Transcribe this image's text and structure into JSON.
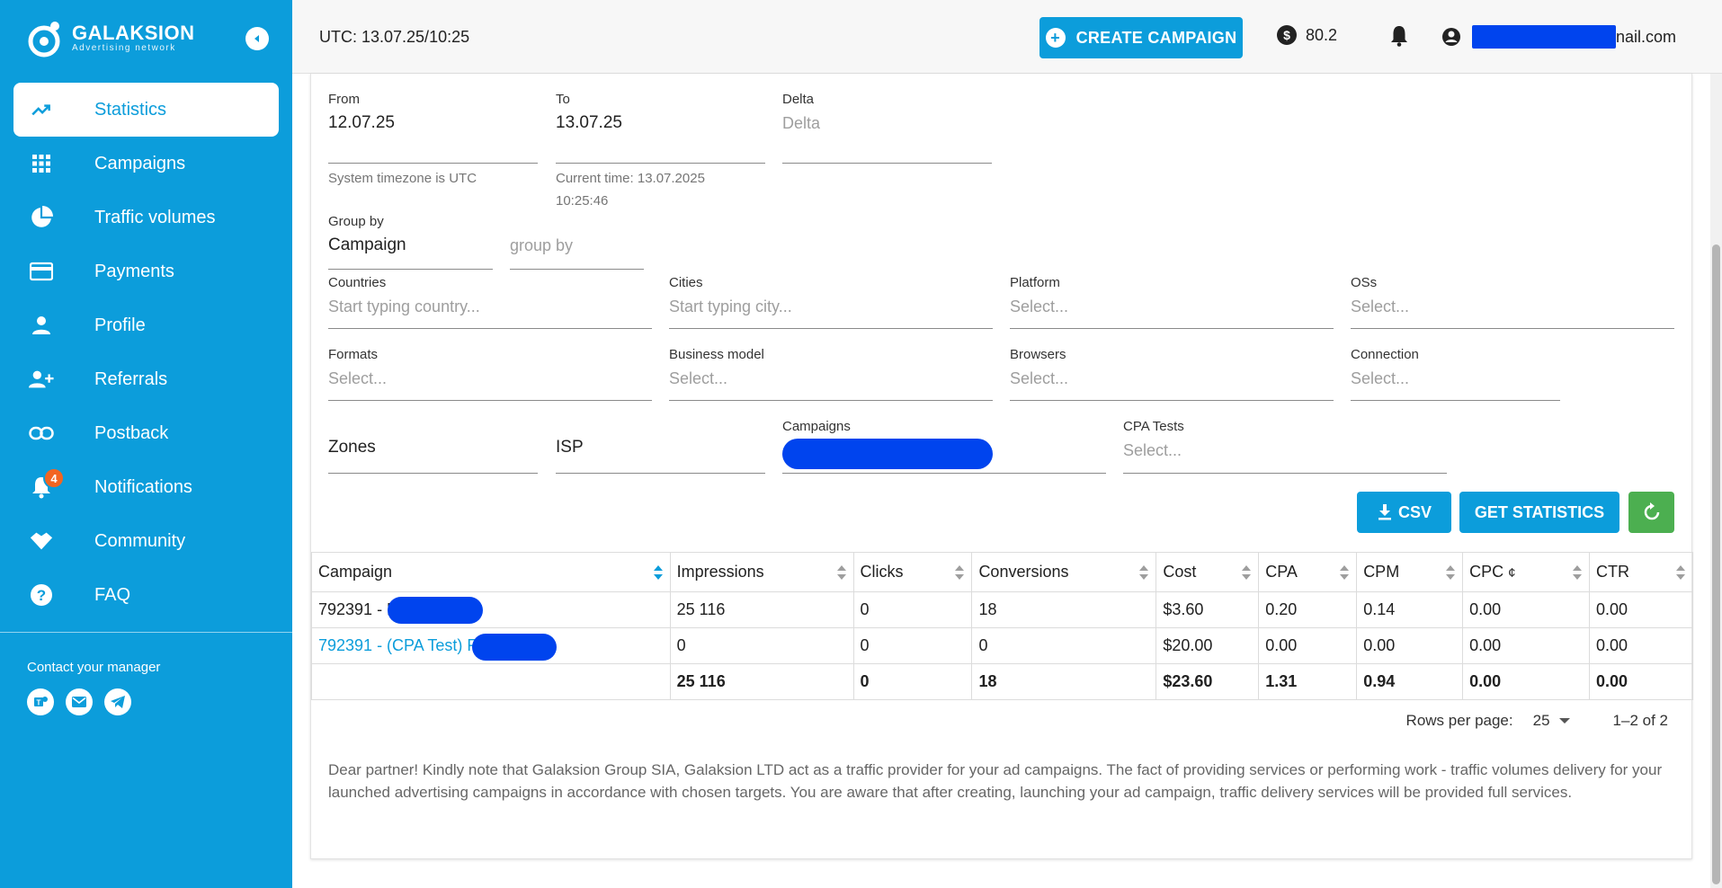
{
  "brand": {
    "name": "GALAKSION",
    "tagline": "Advertising network"
  },
  "sidebar": {
    "items": [
      {
        "label": "Statistics",
        "icon": "trending-up-icon",
        "active": true
      },
      {
        "label": "Campaigns",
        "icon": "grid-icon"
      },
      {
        "label": "Traffic volumes",
        "icon": "pie-chart-icon"
      },
      {
        "label": "Payments",
        "icon": "credit-card-icon"
      },
      {
        "label": "Profile",
        "icon": "person-icon"
      },
      {
        "label": "Referrals",
        "icon": "add-user-icon"
      },
      {
        "label": "Postback",
        "icon": "link-icon"
      },
      {
        "label": "Notifications",
        "icon": "bell-icon",
        "badge": "4"
      },
      {
        "label": "Community",
        "icon": "handshake-icon"
      },
      {
        "label": "FAQ",
        "icon": "help-icon"
      }
    ],
    "contact_label": "Contact your manager",
    "contact_icons": [
      "teams-icon",
      "mail-icon",
      "telegram-icon"
    ]
  },
  "header": {
    "utc": "UTC: 13.07.25/10:25",
    "create_label": "CREATE CAMPAIGN",
    "balance": "80.2",
    "email_suffix": "nail.com"
  },
  "filters": {
    "from": {
      "label": "From",
      "value": "12.07.25",
      "hint": "System timezone is UTC"
    },
    "to": {
      "label": "To",
      "value": "13.07.25",
      "hint_line1": "Current time: 13.07.2025",
      "hint_line2": "10:25:46"
    },
    "delta": {
      "label": "Delta",
      "placeholder": "Delta"
    },
    "group_by": {
      "label": "Group by",
      "value": "Campaign",
      "placeholder": "group by"
    },
    "countries": {
      "label": "Countries",
      "placeholder": "Start typing country..."
    },
    "cities": {
      "label": "Cities",
      "placeholder": "Start typing city..."
    },
    "platform": {
      "label": "Platform",
      "placeholder": "Select..."
    },
    "oss": {
      "label": "OSs",
      "placeholder": "Select..."
    },
    "formats": {
      "label": "Formats",
      "placeholder": "Select..."
    },
    "business_model": {
      "label": "Business model",
      "placeholder": "Select..."
    },
    "browsers": {
      "label": "Browsers",
      "placeholder": "Select..."
    },
    "connection": {
      "label": "Connection",
      "placeholder": "Select..."
    },
    "zones": {
      "value": "Zones"
    },
    "isp": {
      "value": "ISP"
    },
    "campaigns": {
      "label": "Campaigns"
    },
    "cpa_tests": {
      "label": "CPA Tests",
      "placeholder": "Select..."
    }
  },
  "actions": {
    "csv_label": "CSV",
    "get_label": "GET STATISTICS"
  },
  "table": {
    "columns": [
      "Campaign",
      "Impressions",
      "Clicks",
      "Conversions",
      "Cost",
      "CPA",
      "CPM",
      "CPC",
      "CTR"
    ],
    "rows": [
      [
        "792391 - R",
        "25 116",
        "0",
        "18",
        "$3.60",
        "0.20",
        "0.14",
        "0.00",
        "0.00"
      ],
      [
        "792391 - (CPA Test) R",
        "0",
        "0",
        "0",
        "$20.00",
        "0.00",
        "0.00",
        "0.00",
        "0.00"
      ]
    ],
    "totals": [
      "",
      "25 116",
      "0",
      "18",
      "$23.60",
      "1.31",
      "0.94",
      "0.00",
      "0.00"
    ]
  },
  "pagination": {
    "rows_label": "Rows per page:",
    "rows_value": "25",
    "range": "1–2 of 2"
  },
  "note": "Dear partner! Kindly note that Galaksion Group SIA, Galaksion LTD act as a traffic provider for your ad campaigns. The fact of providing services or performing work - traffic volumes delivery for your launched advertising campaigns in accordance with chosen targets. You are aware that after creating, launching your ad campaign, traffic delivery services will be provided full services."
}
